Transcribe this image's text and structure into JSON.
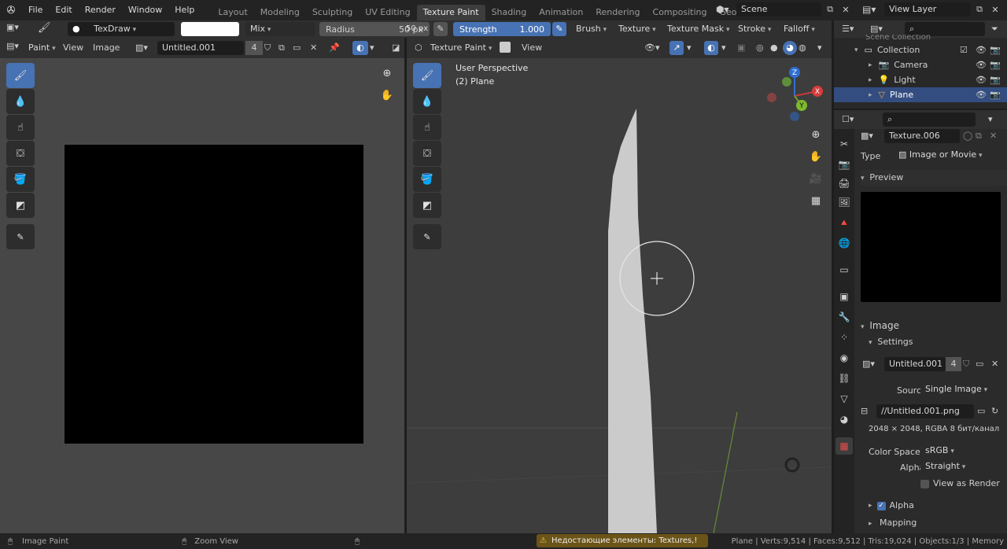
{
  "menu": [
    "File",
    "Edit",
    "Render",
    "Window",
    "Help"
  ],
  "workspaces": [
    "Layout",
    "Modeling",
    "Sculpting",
    "UV Editing",
    "Texture Paint",
    "Shading",
    "Animation",
    "Rendering",
    "Compositing",
    "Geometry Nod"
  ],
  "active_workspace_index": 4,
  "scene": "Scene",
  "view_layer": "View Layer",
  "tool_header": {
    "brush_name": "TexDraw",
    "blend": "Mix",
    "radius_label": "Radius",
    "radius_value": "50 px",
    "radius_value2": "50 px",
    "strength_label": "Strength",
    "strength_value": "1.000",
    "brush_menu": "Brush",
    "texture_menu": "Texture",
    "texture_mask_menu": "Texture Mask",
    "stroke_menu": "Stroke",
    "falloff_menu": "Falloff"
  },
  "image_editor": {
    "mode": "Paint",
    "view": "View",
    "image_menu": "Image",
    "image_name": "Untitled.001",
    "users": "4"
  },
  "viewport": {
    "mode": "Texture Paint",
    "view": "View",
    "perspective": "User Perspective",
    "object": "(2) Plane"
  },
  "outliner": {
    "partial_top": "Scene Collection",
    "collection": "Collection",
    "items": [
      "Camera",
      "Light",
      "Plane"
    ]
  },
  "properties": {
    "texture_name": "Texture.006",
    "type_label": "Type",
    "type_value": "Image or Movie",
    "preview_label": "Preview",
    "image_label": "Image",
    "settings_label": "Settings",
    "image_name": "Untitled.001",
    "image_users": "4",
    "source_label": "Source",
    "source_value": "Single Image",
    "filepath": "//Untitled.001.png",
    "info": "2048 × 2048,  RGBA 8 бит/канал",
    "color_space_label": "Color Space",
    "color_space_value": "sRGB",
    "alpha_label": "Alpha",
    "alpha_value": "Straight",
    "view_as_render": "View as Render",
    "alpha_panel": "Alpha",
    "mapping_panel": "Mapping"
  },
  "statusbar": {
    "left1": "Image Paint",
    "left2": "Zoom View",
    "warning": "Недостающие элементы: Textures,!",
    "right": "Plane | Verts:9,514 | Faces:9,512 | Tris:19,024 | Objects:1/3 | Memory"
  },
  "colors": {
    "accent": "#4772b3",
    "header": "#303030",
    "viewport_bg": "#3d3d3d",
    "image_editor_bg": "#474747"
  }
}
